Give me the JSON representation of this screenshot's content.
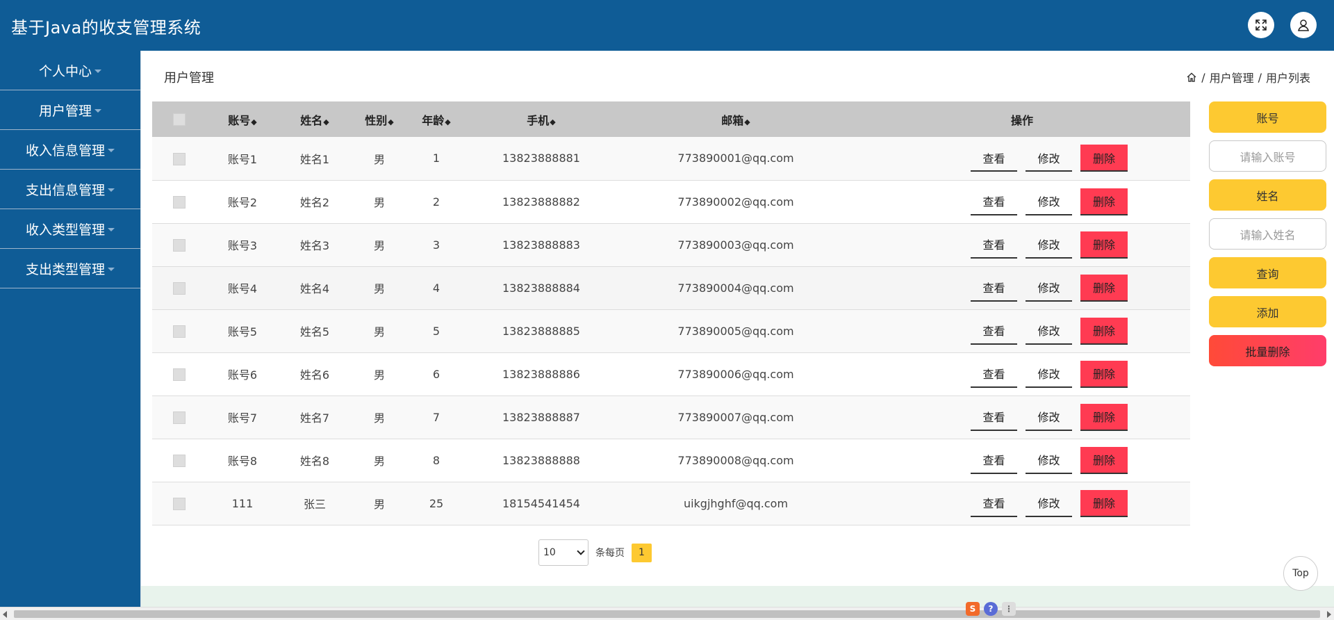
{
  "app": {
    "title": "基于Java的收支管理系统"
  },
  "header": {
    "fullscreen_icon": "expand-icon",
    "user_icon": "user-icon"
  },
  "sidebar": {
    "items": [
      {
        "label": "个人中心"
      },
      {
        "label": "用户管理"
      },
      {
        "label": "收入信息管理"
      },
      {
        "label": "支出信息管理"
      },
      {
        "label": "收入类型管理"
      },
      {
        "label": "支出类型管理"
      }
    ]
  },
  "main": {
    "title": "用户管理",
    "breadcrumb": {
      "sep": "/",
      "item1": "用户管理",
      "item2": "用户列表"
    }
  },
  "table": {
    "headers": {
      "account": "账号",
      "name": "姓名",
      "gender": "性别",
      "age": "年龄",
      "phone": "手机",
      "email": "邮箱",
      "action": "操作"
    },
    "sort_glyph": "◆",
    "rows": [
      {
        "account": "账号1",
        "name": "姓名1",
        "gender": "男",
        "age": "1",
        "phone": "13823888881",
        "email": "773890001@qq.com"
      },
      {
        "account": "账号2",
        "name": "姓名2",
        "gender": "男",
        "age": "2",
        "phone": "13823888882",
        "email": "773890002@qq.com"
      },
      {
        "account": "账号3",
        "name": "姓名3",
        "gender": "男",
        "age": "3",
        "phone": "13823888883",
        "email": "773890003@qq.com"
      },
      {
        "account": "账号4",
        "name": "姓名4",
        "gender": "男",
        "age": "4",
        "phone": "13823888884",
        "email": "773890004@qq.com"
      },
      {
        "account": "账号5",
        "name": "姓名5",
        "gender": "男",
        "age": "5",
        "phone": "13823888885",
        "email": "773890005@qq.com"
      },
      {
        "account": "账号6",
        "name": "姓名6",
        "gender": "男",
        "age": "6",
        "phone": "13823888886",
        "email": "773890006@qq.com"
      },
      {
        "account": "账号7",
        "name": "姓名7",
        "gender": "男",
        "age": "7",
        "phone": "13823888887",
        "email": "773890007@qq.com"
      },
      {
        "account": "账号8",
        "name": "姓名8",
        "gender": "男",
        "age": "8",
        "phone": "13823888888",
        "email": "773890008@qq.com"
      },
      {
        "account": "111",
        "name": "张三",
        "gender": "男",
        "age": "25",
        "phone": "18154541454",
        "email": "uikgjhghf@qq.com"
      }
    ],
    "actions": {
      "view": "查看",
      "edit": "修改",
      "delete": "删除"
    }
  },
  "pagination": {
    "page_size": "10",
    "per_page_label": "条每页",
    "current_page": "1"
  },
  "search_panel": {
    "account_label": "账号",
    "account_placeholder": "请输入账号",
    "name_label": "姓名",
    "name_placeholder": "请输入姓名",
    "query_button": "查询",
    "add_button": "添加",
    "batch_delete_button": "批量删除"
  },
  "top_button": "Top",
  "colors": {
    "header_bg": "#0f5c96",
    "accent_yellow": "#fdc931",
    "danger": "#ff3b52"
  }
}
